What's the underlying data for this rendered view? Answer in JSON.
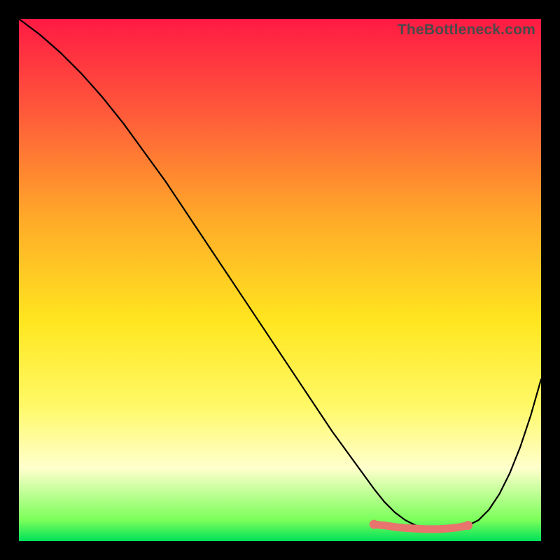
{
  "chart_data": {
    "type": "line",
    "watermark": "TheBottleneck.com",
    "title": "",
    "xlabel": "",
    "ylabel": "",
    "xlim": [
      0,
      100
    ],
    "ylim": [
      0,
      100
    ],
    "series": [
      {
        "name": "bottleneck-curve",
        "x": [
          0,
          4,
          8,
          12,
          16,
          20,
          24,
          28,
          32,
          36,
          40,
          44,
          48,
          52,
          56,
          60,
          64,
          68,
          70,
          72,
          74,
          76,
          78,
          80,
          82,
          84,
          86,
          88,
          90,
          92,
          94,
          96,
          98,
          100
        ],
        "y": [
          100,
          97,
          93.5,
          89.5,
          85,
          80,
          74.5,
          69,
          63,
          57,
          51,
          45,
          39,
          33,
          27,
          21,
          15.5,
          10,
          7.5,
          5.5,
          4,
          3,
          2.5,
          2.3,
          2.3,
          2.5,
          3,
          4,
          6,
          9,
          13,
          18,
          24,
          31
        ]
      }
    ],
    "highlight": {
      "x": [
        68,
        70,
        72,
        74,
        76,
        78,
        80,
        82,
        84,
        86
      ],
      "y": [
        3.2,
        3.0,
        2.7,
        2.5,
        2.4,
        2.3,
        2.3,
        2.4,
        2.6,
        3.0
      ]
    },
    "colors": {
      "curve": "#000000",
      "highlight": "#e9736d",
      "gradient_top": "#ff1a44",
      "gradient_bottom": "#00e05a"
    }
  }
}
